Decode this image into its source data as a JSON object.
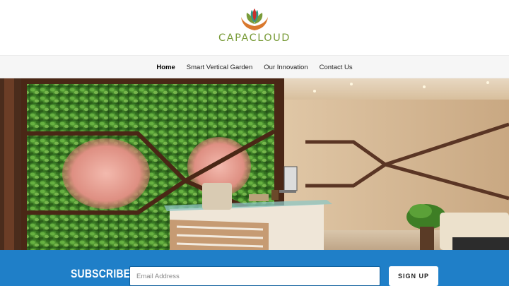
{
  "brand": {
    "name": "CAPACLOUD",
    "logo_icon": "lotus-hands-icon",
    "colors": {
      "leaf_green": "#7a9c3a",
      "hand_orange": "#d9782d",
      "flower_teal": "#2f9a8a",
      "flower_red": "#c9302c"
    }
  },
  "nav": {
    "items": [
      {
        "label": "Home",
        "active": true
      },
      {
        "label": "Smart Vertical Garden",
        "active": false
      },
      {
        "label": "Our Innovation",
        "active": false
      },
      {
        "label": "Contact Us",
        "active": false
      }
    ]
  },
  "hero": {
    "image": "vertical-garden-office-reception-photo"
  },
  "subscribe": {
    "title": "SUBSCRIBE",
    "email_placeholder": "Email Address",
    "email_value": "",
    "button_label": "SIGN UP",
    "background_color": "#1f7fc8"
  }
}
